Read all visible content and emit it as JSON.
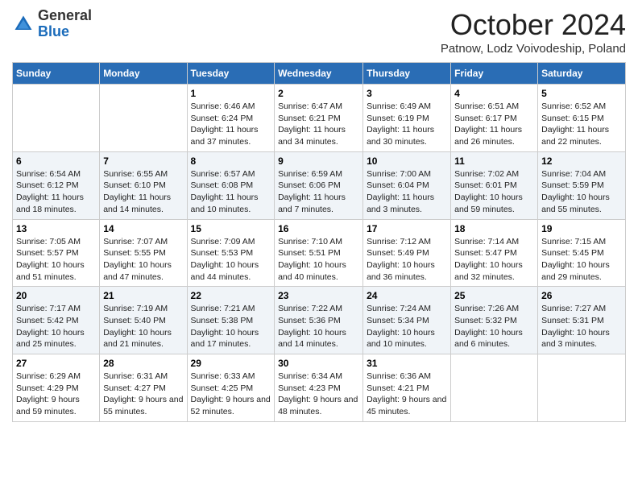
{
  "header": {
    "logo_general": "General",
    "logo_blue": "Blue",
    "month_title": "October 2024",
    "subtitle": "Patnow, Lodz Voivodeship, Poland"
  },
  "weekdays": [
    "Sunday",
    "Monday",
    "Tuesday",
    "Wednesday",
    "Thursday",
    "Friday",
    "Saturday"
  ],
  "weeks": [
    [
      {
        "day": "",
        "info": ""
      },
      {
        "day": "",
        "info": ""
      },
      {
        "day": "1",
        "info": "Sunrise: 6:46 AM\nSunset: 6:24 PM\nDaylight: 11 hours and 37 minutes."
      },
      {
        "day": "2",
        "info": "Sunrise: 6:47 AM\nSunset: 6:21 PM\nDaylight: 11 hours and 34 minutes."
      },
      {
        "day": "3",
        "info": "Sunrise: 6:49 AM\nSunset: 6:19 PM\nDaylight: 11 hours and 30 minutes."
      },
      {
        "day": "4",
        "info": "Sunrise: 6:51 AM\nSunset: 6:17 PM\nDaylight: 11 hours and 26 minutes."
      },
      {
        "day": "5",
        "info": "Sunrise: 6:52 AM\nSunset: 6:15 PM\nDaylight: 11 hours and 22 minutes."
      }
    ],
    [
      {
        "day": "6",
        "info": "Sunrise: 6:54 AM\nSunset: 6:12 PM\nDaylight: 11 hours and 18 minutes."
      },
      {
        "day": "7",
        "info": "Sunrise: 6:55 AM\nSunset: 6:10 PM\nDaylight: 11 hours and 14 minutes."
      },
      {
        "day": "8",
        "info": "Sunrise: 6:57 AM\nSunset: 6:08 PM\nDaylight: 11 hours and 10 minutes."
      },
      {
        "day": "9",
        "info": "Sunrise: 6:59 AM\nSunset: 6:06 PM\nDaylight: 11 hours and 7 minutes."
      },
      {
        "day": "10",
        "info": "Sunrise: 7:00 AM\nSunset: 6:04 PM\nDaylight: 11 hours and 3 minutes."
      },
      {
        "day": "11",
        "info": "Sunrise: 7:02 AM\nSunset: 6:01 PM\nDaylight: 10 hours and 59 minutes."
      },
      {
        "day": "12",
        "info": "Sunrise: 7:04 AM\nSunset: 5:59 PM\nDaylight: 10 hours and 55 minutes."
      }
    ],
    [
      {
        "day": "13",
        "info": "Sunrise: 7:05 AM\nSunset: 5:57 PM\nDaylight: 10 hours and 51 minutes."
      },
      {
        "day": "14",
        "info": "Sunrise: 7:07 AM\nSunset: 5:55 PM\nDaylight: 10 hours and 47 minutes."
      },
      {
        "day": "15",
        "info": "Sunrise: 7:09 AM\nSunset: 5:53 PM\nDaylight: 10 hours and 44 minutes."
      },
      {
        "day": "16",
        "info": "Sunrise: 7:10 AM\nSunset: 5:51 PM\nDaylight: 10 hours and 40 minutes."
      },
      {
        "day": "17",
        "info": "Sunrise: 7:12 AM\nSunset: 5:49 PM\nDaylight: 10 hours and 36 minutes."
      },
      {
        "day": "18",
        "info": "Sunrise: 7:14 AM\nSunset: 5:47 PM\nDaylight: 10 hours and 32 minutes."
      },
      {
        "day": "19",
        "info": "Sunrise: 7:15 AM\nSunset: 5:45 PM\nDaylight: 10 hours and 29 minutes."
      }
    ],
    [
      {
        "day": "20",
        "info": "Sunrise: 7:17 AM\nSunset: 5:42 PM\nDaylight: 10 hours and 25 minutes."
      },
      {
        "day": "21",
        "info": "Sunrise: 7:19 AM\nSunset: 5:40 PM\nDaylight: 10 hours and 21 minutes."
      },
      {
        "day": "22",
        "info": "Sunrise: 7:21 AM\nSunset: 5:38 PM\nDaylight: 10 hours and 17 minutes."
      },
      {
        "day": "23",
        "info": "Sunrise: 7:22 AM\nSunset: 5:36 PM\nDaylight: 10 hours and 14 minutes."
      },
      {
        "day": "24",
        "info": "Sunrise: 7:24 AM\nSunset: 5:34 PM\nDaylight: 10 hours and 10 minutes."
      },
      {
        "day": "25",
        "info": "Sunrise: 7:26 AM\nSunset: 5:32 PM\nDaylight: 10 hours and 6 minutes."
      },
      {
        "day": "26",
        "info": "Sunrise: 7:27 AM\nSunset: 5:31 PM\nDaylight: 10 hours and 3 minutes."
      }
    ],
    [
      {
        "day": "27",
        "info": "Sunrise: 6:29 AM\nSunset: 4:29 PM\nDaylight: 9 hours and 59 minutes."
      },
      {
        "day": "28",
        "info": "Sunrise: 6:31 AM\nSunset: 4:27 PM\nDaylight: 9 hours and 55 minutes."
      },
      {
        "day": "29",
        "info": "Sunrise: 6:33 AM\nSunset: 4:25 PM\nDaylight: 9 hours and 52 minutes."
      },
      {
        "day": "30",
        "info": "Sunrise: 6:34 AM\nSunset: 4:23 PM\nDaylight: 9 hours and 48 minutes."
      },
      {
        "day": "31",
        "info": "Sunrise: 6:36 AM\nSunset: 4:21 PM\nDaylight: 9 hours and 45 minutes."
      },
      {
        "day": "",
        "info": ""
      },
      {
        "day": "",
        "info": ""
      }
    ]
  ]
}
